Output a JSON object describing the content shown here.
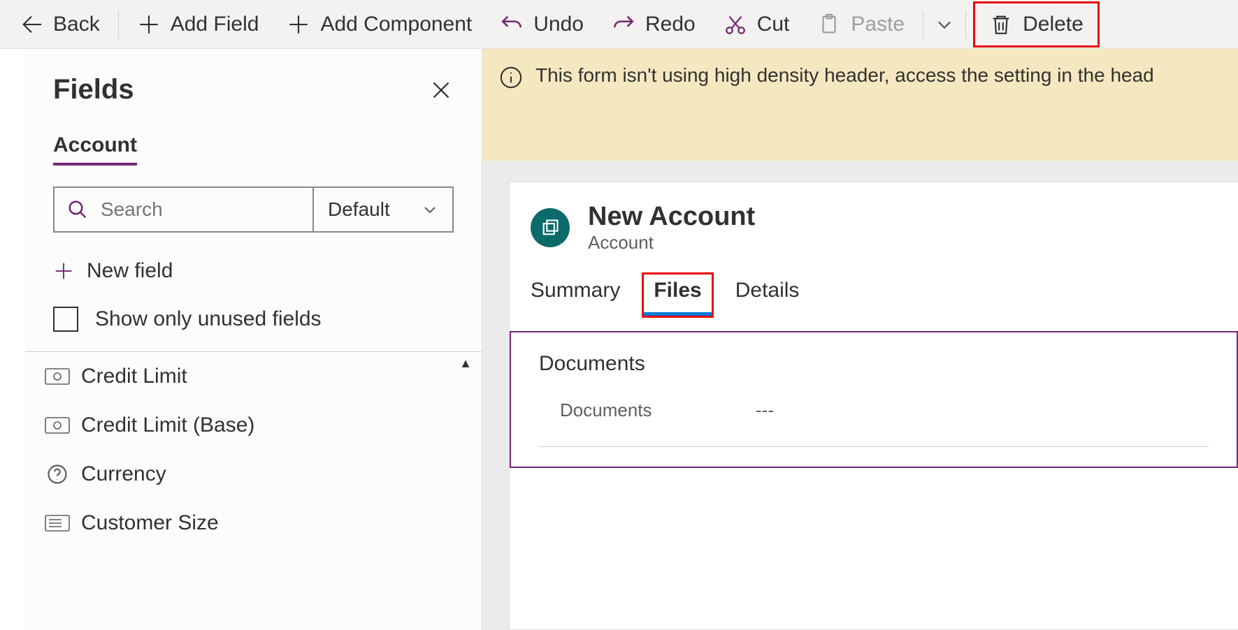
{
  "toolbar": {
    "back": "Back",
    "add_field": "Add Field",
    "add_component": "Add Component",
    "undo": "Undo",
    "redo": "Redo",
    "cut": "Cut",
    "paste": "Paste",
    "delete": "Delete"
  },
  "panel": {
    "title": "Fields",
    "tab": "Account",
    "search_placeholder": "Search",
    "filter_label": "Default",
    "new_field": "New field",
    "show_unused": "Show only unused fields",
    "items": [
      {
        "label": "Credit Limit"
      },
      {
        "label": "Credit Limit (Base)"
      },
      {
        "label": "Currency"
      },
      {
        "label": "Customer Size"
      }
    ]
  },
  "banner": {
    "text": "This form isn't using high density header, access the setting in the head"
  },
  "form": {
    "title": "New Account",
    "subtitle": "Account",
    "tabs": {
      "summary": "Summary",
      "files": "Files",
      "details": "Details"
    },
    "section": {
      "title": "Documents",
      "row_label": "Documents",
      "row_value": "---"
    }
  }
}
